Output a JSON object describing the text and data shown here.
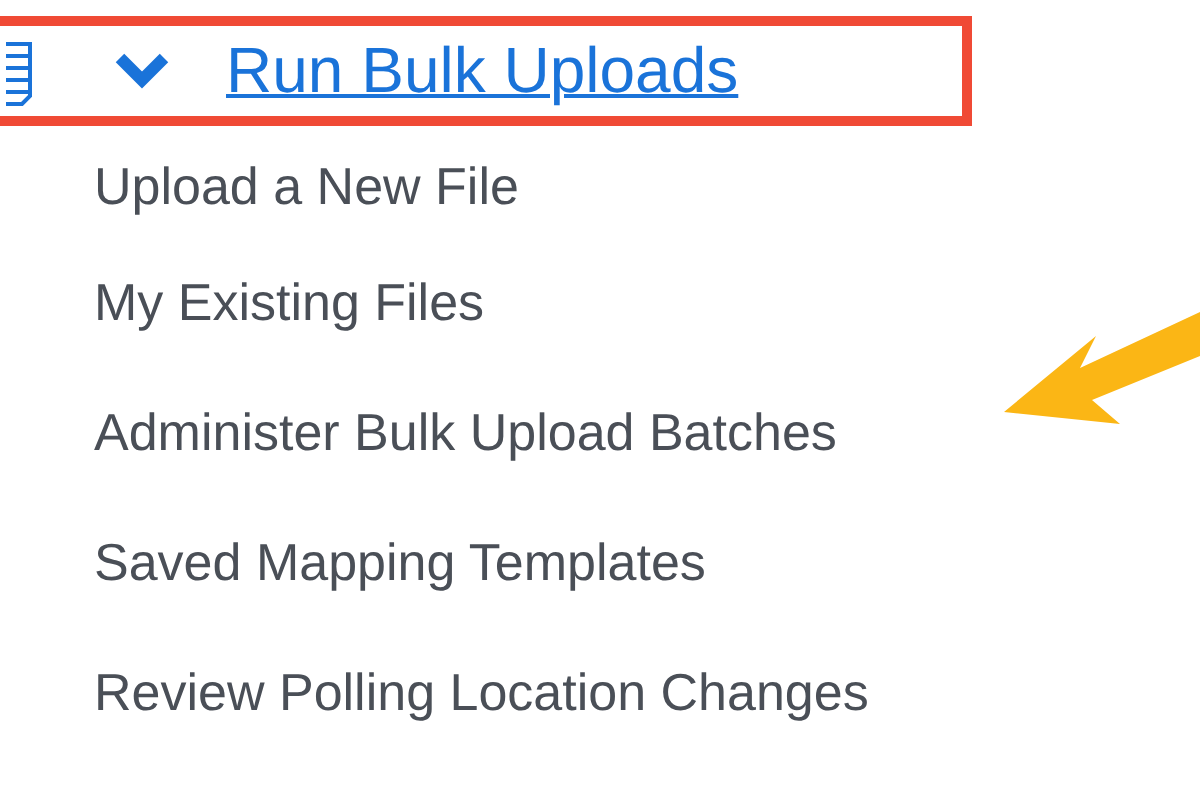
{
  "section": {
    "label": "Run Bulk Uploads",
    "expanded": true
  },
  "items": [
    {
      "label": "Upload a New File"
    },
    {
      "label": "My Existing Files"
    },
    {
      "label": "Administer Bulk Upload Batches"
    },
    {
      "label": "Saved Mapping Templates"
    },
    {
      "label": "Review Polling Location Changes"
    }
  ]
}
